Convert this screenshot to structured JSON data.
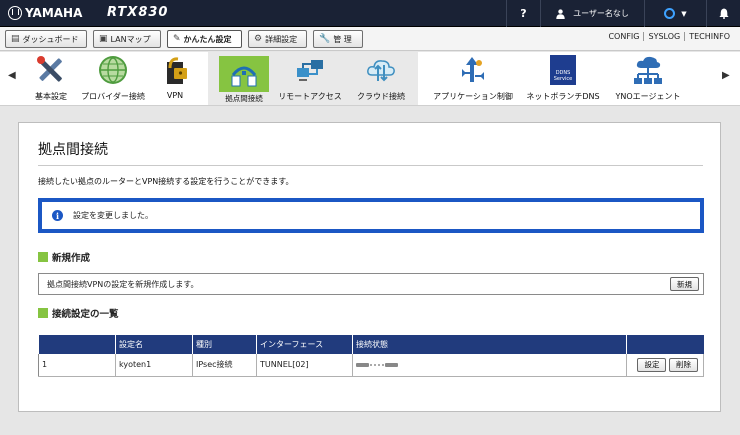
{
  "topbar": {
    "brand": "YAMAHA",
    "model": "RTX830",
    "help_label": "?",
    "user_label": "ユーザー名なし",
    "power_label": "O",
    "accent": "#1a2235"
  },
  "nav": {
    "buttons": [
      "ダッシュボード",
      "LANマップ",
      "かんたん設定",
      "詳細設定",
      "管 理"
    ],
    "active": "かんたん設定",
    "links": [
      "CONFIG",
      "SYSLOG",
      "TECHINFO"
    ]
  },
  "iconbar": {
    "items": [
      {
        "label": "基本設定",
        "icon": "tools-icon"
      },
      {
        "label": "プロバイダー接続",
        "icon": "globe-icon"
      },
      {
        "label": "VPN",
        "icon": "vpn-lock-icon"
      },
      {
        "label": "拠点間接続",
        "icon": "site-to-site-icon"
      },
      {
        "label": "リモートアクセス",
        "icon": "remote-access-icon"
      },
      {
        "label": "クラウド接続",
        "icon": "cloud-connect-icon"
      },
      {
        "label": "アプリケーション制御",
        "icon": "app-control-icon"
      },
      {
        "label": "ネットボランチDNS",
        "icon": "ddns-icon"
      },
      {
        "label": "YNOエージェント",
        "icon": "yno-agent-icon"
      }
    ],
    "active_index": 3,
    "ddns_icon_text": "DDNS Service",
    "active_color": "#86c441"
  },
  "page": {
    "title": "拠点間接続",
    "description": "接続したい拠点のルーターとVPN接続する設定を行うことができます。",
    "notice": "設定を変更しました。",
    "notice_icon": "i",
    "new_section": {
      "heading": "新規作成",
      "text": "拠点間接続VPNの設定を新規作成します。",
      "button": "新規"
    },
    "list_section": {
      "heading": "接続設定の一覧",
      "columns": [
        "",
        "設定名",
        "種別",
        "インターフェース",
        "接続状態",
        ""
      ],
      "rows": [
        {
          "no": "1",
          "name": "kyoten1",
          "type": "IPsec接続",
          "interface": "TUNNEL[02]",
          "status": "disconnected",
          "edit": "設定",
          "delete": "削除"
        }
      ]
    }
  }
}
